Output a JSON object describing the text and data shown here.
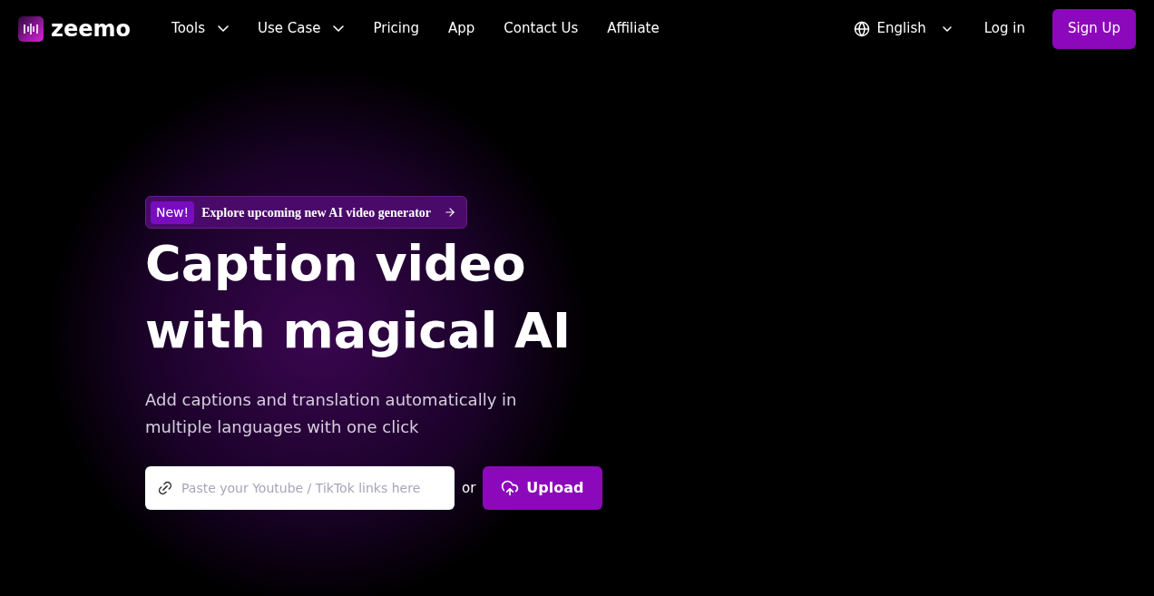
{
  "brand": {
    "name": "zeemo"
  },
  "nav": [
    {
      "label": "Tools",
      "dropdown": true
    },
    {
      "label": "Use Case",
      "dropdown": true
    },
    {
      "label": "Pricing",
      "dropdown": false
    },
    {
      "label": "App",
      "dropdown": false
    },
    {
      "label": "Contact Us",
      "dropdown": false
    },
    {
      "label": "Affiliate",
      "dropdown": false
    }
  ],
  "language": {
    "label": "English"
  },
  "login": "Log in",
  "signup": "Sign Up",
  "announcement": {
    "badge": "New!",
    "text": "Explore upcoming new AI video generator"
  },
  "hero": {
    "title_lines": [
      "Caption video",
      "with magical AI"
    ],
    "subtitle": "Add captions and translation automatically in multiple languages with one click"
  },
  "link_input": {
    "placeholder": "Paste your Youtube / TikTok links here"
  },
  "or": "or",
  "upload": "Upload"
}
